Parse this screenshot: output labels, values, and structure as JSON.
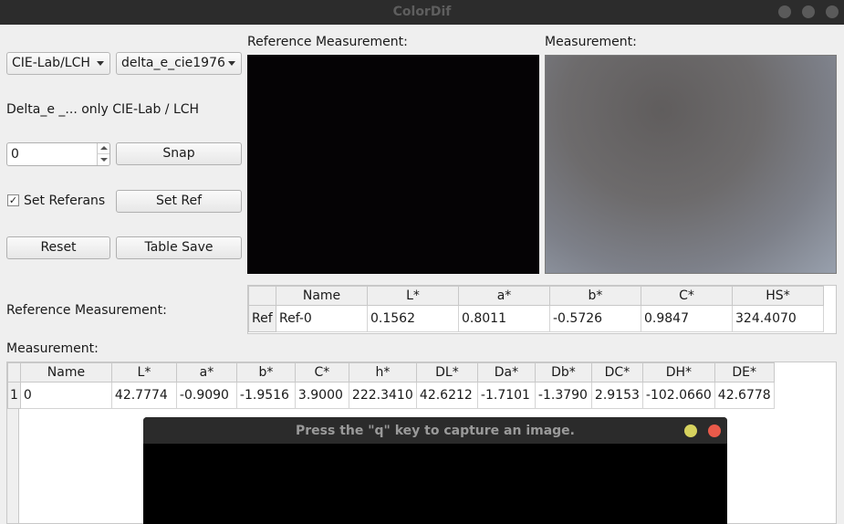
{
  "window": {
    "title": "ColorDif",
    "colors": {
      "titlebar": "#2c2c2c",
      "title_text": "#5e5e5e"
    }
  },
  "controls": {
    "colorspace_select": "CIE-Lab/LCH",
    "delta_e_select": "delta_e_cie1976",
    "note": "Delta_e _... only CIE-Lab / LCH",
    "index_value": "0",
    "snap_label": "Snap",
    "set_referans_label": "Set Referans",
    "set_referans_checked": true,
    "check_mark": "✓",
    "set_ref_label": "Set Ref",
    "reset_label": "Reset",
    "table_save_label": "Table Save"
  },
  "previews": {
    "reference_label": "Reference Measurement:",
    "measurement_label": "Measurement:",
    "reference_color": "#050305",
    "measurement_colors": [
      "#6c6a6a",
      "#8a8e97",
      "#9aa0ac"
    ]
  },
  "reference_table": {
    "section_label": "Reference Measurement:",
    "headers": [
      "Name",
      "L*",
      "a*",
      "b*",
      "C*",
      "HS*"
    ],
    "row_header": "Ref",
    "row": [
      "Ref-0",
      "0.1562",
      "0.8011",
      "-0.5726",
      "0.9847",
      "324.4070"
    ]
  },
  "measurement_table": {
    "section_label": "Measurement:",
    "headers": [
      "Name",
      "L*",
      "a*",
      "b*",
      "C*",
      "h*",
      "DL*",
      "Da*",
      "Db*",
      "DC*",
      "DH*",
      "DE*"
    ],
    "row_header": "1",
    "row": [
      "0",
      "42.7774",
      "-0.9090",
      "-1.9516",
      "3.9000",
      "222.3410",
      "42.6212",
      "-1.7101",
      "-1.3790",
      "2.9153",
      "-102.0660",
      "42.6778"
    ]
  },
  "capture_window": {
    "title": "Press the \"q\" key to capture an image.",
    "colors": {
      "minimize": "#d6d25e",
      "close": "#e95a4a"
    }
  }
}
